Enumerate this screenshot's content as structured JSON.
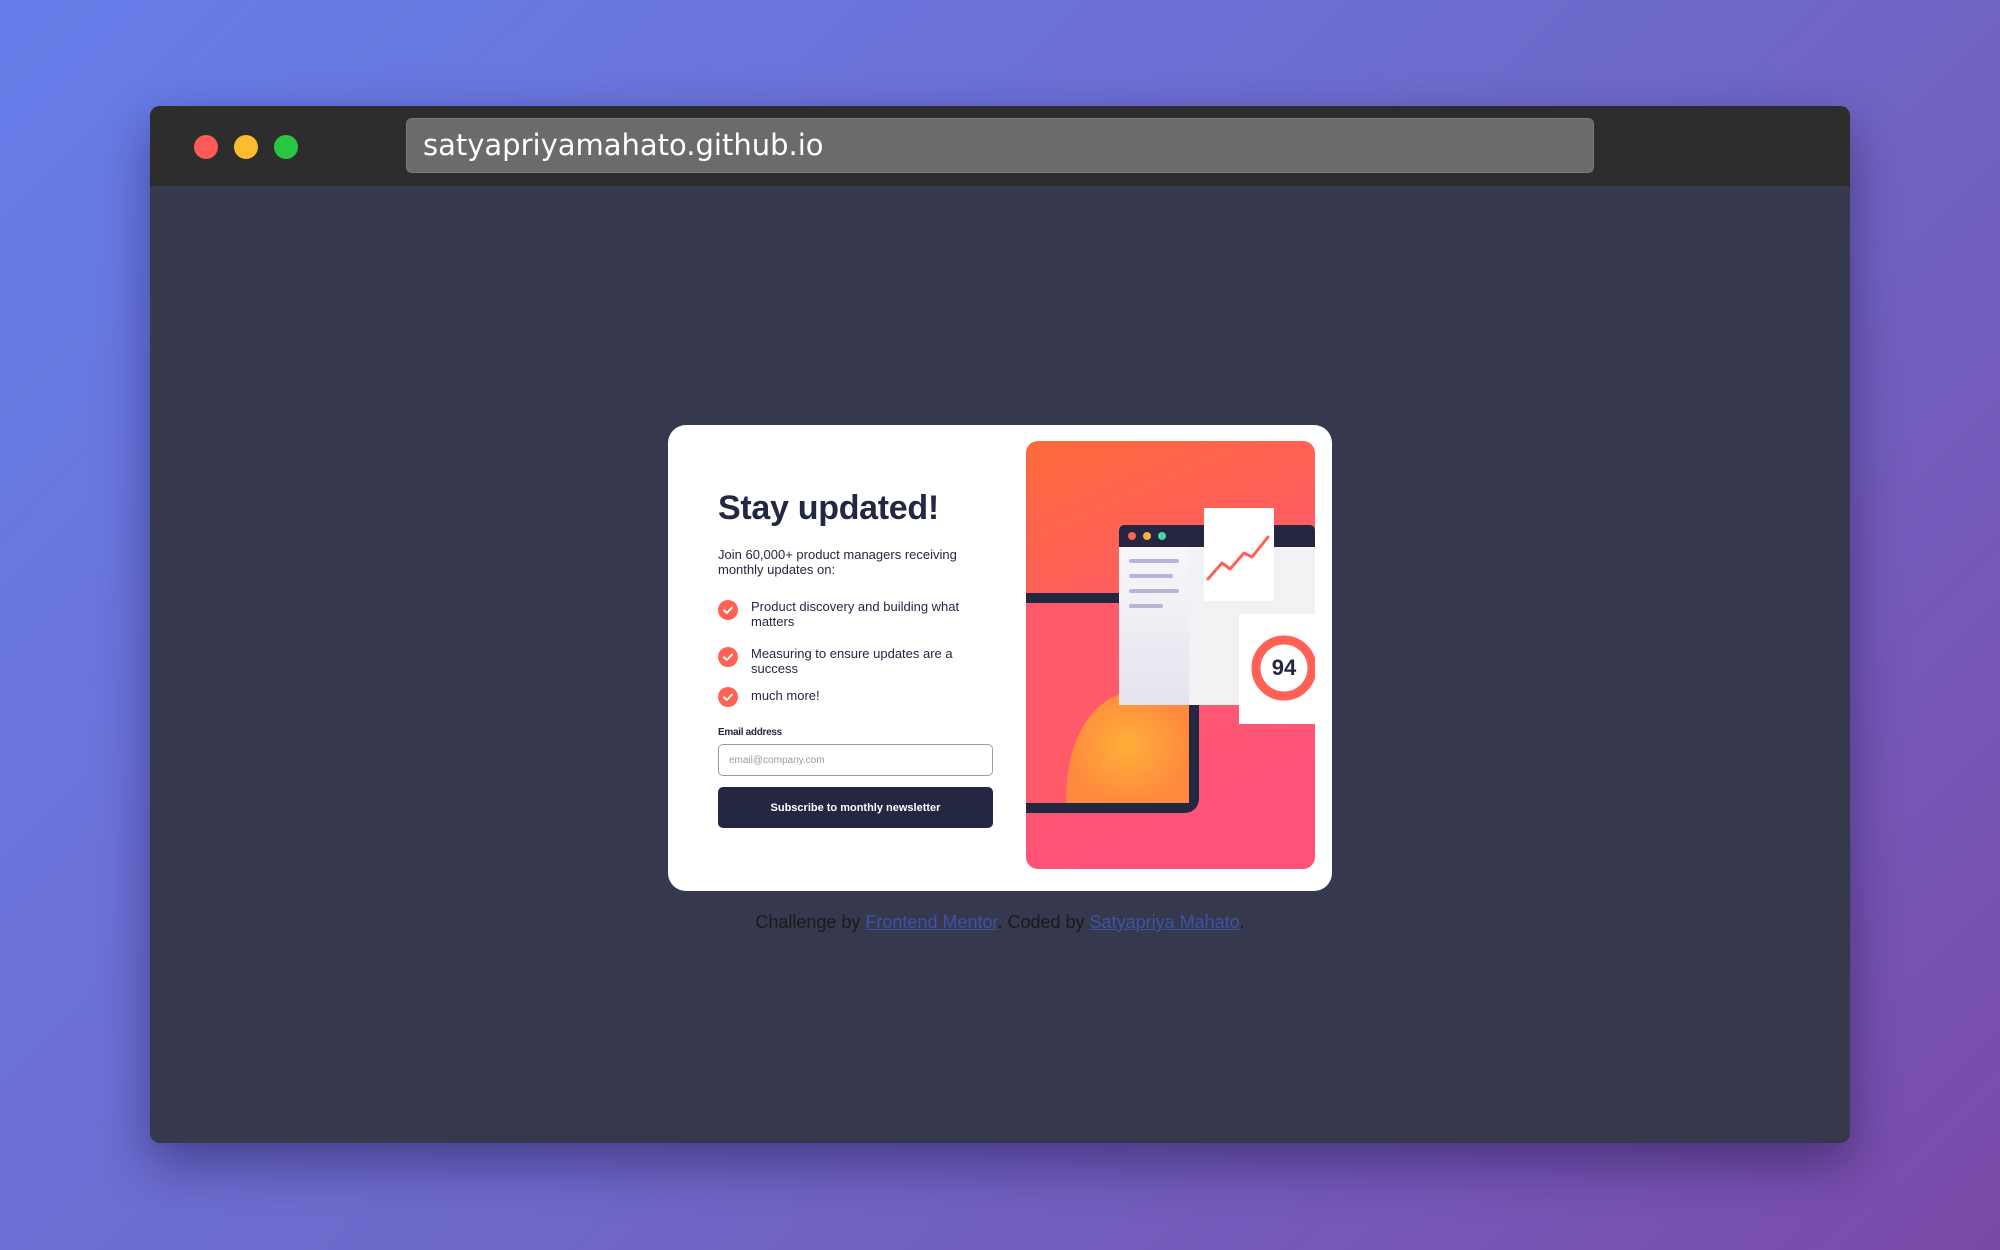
{
  "browser": {
    "url": "satyapriyamahato.github.io"
  },
  "card": {
    "heading": "Stay updated!",
    "intro": "Join 60,000+ product managers receiving monthly updates on:",
    "features": [
      "Product discovery and building what matters",
      "Measuring to ensure updates are a success",
      "much more!"
    ],
    "email_label": "Email address",
    "email_placeholder": "email@company.com",
    "email_value": "",
    "subscribe_label": "Subscribe to monthly newsletter",
    "illustration_score": "94"
  },
  "footer": {
    "prefix": "Challenge by ",
    "link1": "Frontend Mentor",
    "middle": ". Coded by ",
    "link2": "Satyapriya Mahato",
    "suffix": "."
  },
  "colors": {
    "accent": "#ff6155",
    "dark_navy": "#242742",
    "page_bg": "#36384e",
    "card_bg": "#ffffff"
  },
  "icons": {
    "feature_bullet": "check-icon"
  }
}
